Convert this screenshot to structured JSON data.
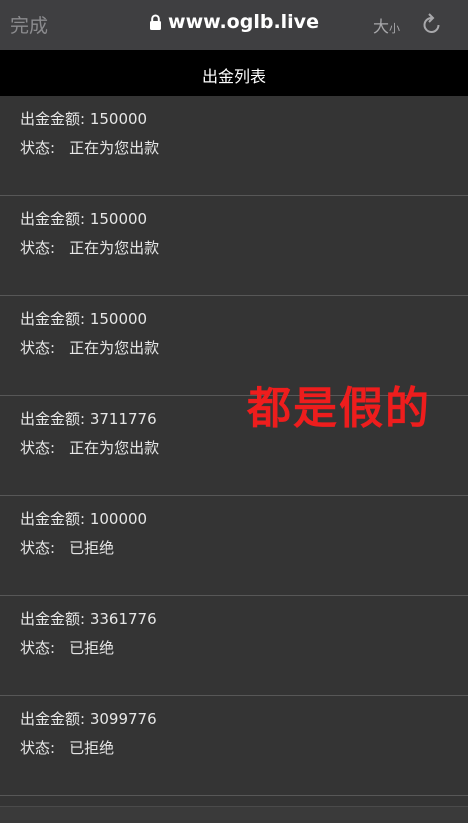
{
  "browser": {
    "done_label": "完成",
    "url": "www.oglb.live",
    "text_size_big": "大",
    "text_size_small": "小"
  },
  "page": {
    "title": "出金列表"
  },
  "labels": {
    "amount": "出金金额:",
    "status": "状态:"
  },
  "items": [
    {
      "amount": "150000",
      "status": "正在为您出款"
    },
    {
      "amount": "150000",
      "status": "正在为您出款"
    },
    {
      "amount": "150000",
      "status": "正在为您出款"
    },
    {
      "amount": "3711776",
      "status": "正在为您出款"
    },
    {
      "amount": "100000",
      "status": "已拒绝"
    },
    {
      "amount": "3361776",
      "status": "已拒绝"
    },
    {
      "amount": "3099776",
      "status": "已拒绝"
    }
  ],
  "overlay": {
    "text": "都是假的",
    "color": "#ee1d1d"
  },
  "icons": [
    "lock-icon",
    "reload-icon"
  ]
}
